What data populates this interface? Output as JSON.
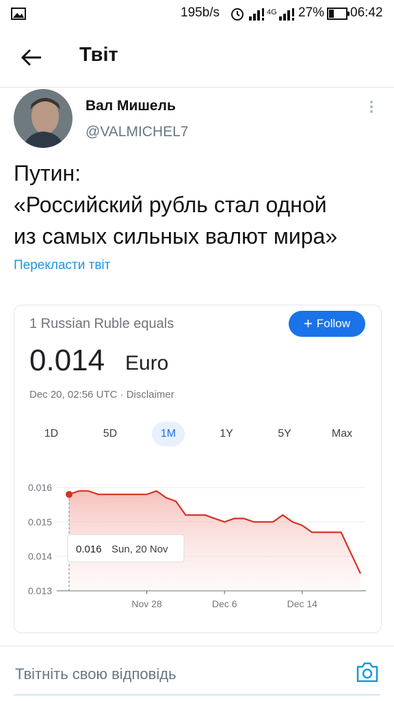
{
  "status_bar": {
    "speed": "195b/s",
    "network": "4G",
    "battery": "27%",
    "time": "06:42",
    "icons": [
      "image-icon",
      "alarm-icon",
      "signal-icon",
      "battery-icon"
    ]
  },
  "header": {
    "title": "Твіт",
    "back_icon": "arrow-left-icon"
  },
  "tweet": {
    "author_name": "Вал Мишель",
    "author_handle": "@VALMICHEL7",
    "text_lines": [
      "Путин:",
      "«Российский рубль стал одной",
      "из самых сильных валют мира»"
    ],
    "translate_label": "Перекласти твіт"
  },
  "card": {
    "header": "1 Russian Ruble equals",
    "follow_label": "Follow",
    "rate_value": "0.014",
    "rate_currency": "Euro",
    "timestamp": "Dec 20, 02:56 UTC · Disclaimer",
    "range_tabs": [
      "1D",
      "5D",
      "1M",
      "1Y",
      "5Y",
      "Max"
    ],
    "selected_tab": "1M",
    "tooltip": {
      "value": "0.016",
      "date": "Sun, 20 Nov"
    }
  },
  "chart_data": {
    "type": "area",
    "x": [
      "Nov 20",
      "Nov 21",
      "Nov 22",
      "Nov 23",
      "Nov 24",
      "Nov 25",
      "Nov 26",
      "Nov 27",
      "Nov 28",
      "Nov 29",
      "Nov 30",
      "Dec 1",
      "Dec 2",
      "Dec 3",
      "Dec 4",
      "Dec 5",
      "Dec 6",
      "Dec 7",
      "Dec 8",
      "Dec 9",
      "Dec 10",
      "Dec 11",
      "Dec 12",
      "Dec 13",
      "Dec 14",
      "Dec 15",
      "Dec 16",
      "Dec 17",
      "Dec 18",
      "Dec 19",
      "Dec 20"
    ],
    "series": [
      {
        "values": [
          0.0158,
          0.0159,
          0.0159,
          0.0158,
          0.0158,
          0.0158,
          0.0158,
          0.0158,
          0.0158,
          0.0159,
          0.0157,
          0.0156,
          0.0152,
          0.0152,
          0.0152,
          0.0151,
          0.015,
          0.0151,
          0.0151,
          0.015,
          0.015,
          0.015,
          0.0152,
          0.015,
          0.0149,
          0.0147,
          0.0147,
          0.0147,
          0.0147,
          0.0141,
          0.0135
        ]
      }
    ],
    "xticks": [
      "Nov 28",
      "Dec 6",
      "Dec 14"
    ],
    "yticks": [
      "0.013",
      "0.014",
      "0.015",
      "0.016"
    ],
    "ylim": [
      0.013,
      0.0165
    ],
    "grid": true,
    "colors": {
      "line": "#d93025",
      "fill": "#fce8e6",
      "tooltip_marker": "#d93025"
    }
  },
  "reply": {
    "placeholder": "Твітніть свою відповідь",
    "camera_icon": "camera-icon"
  },
  "colors": {
    "link": "#1b95e0",
    "follow_button": "#1a73e8",
    "chart_line": "#d93025"
  }
}
